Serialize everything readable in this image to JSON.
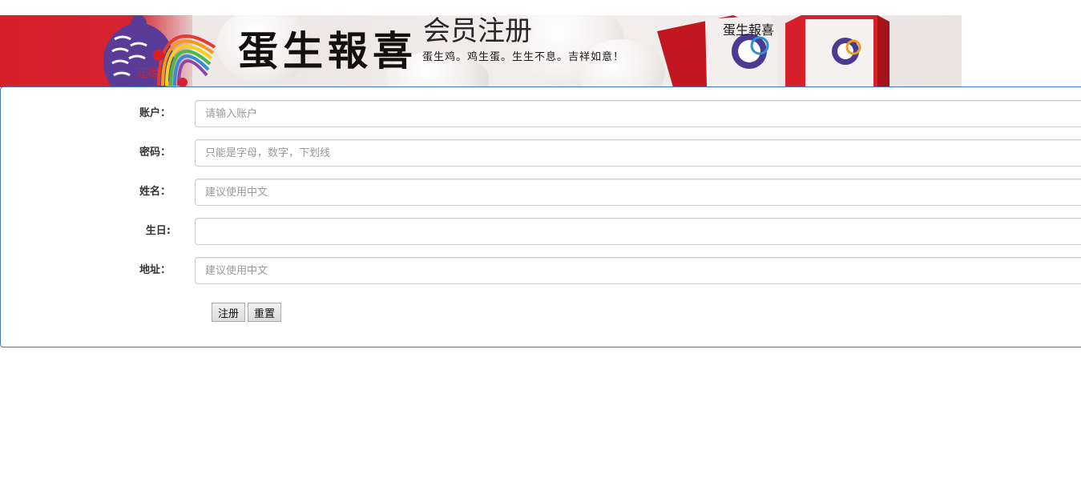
{
  "banner": {
    "logo_text": "元祖",
    "brand_text": "蛋生報喜",
    "title": "会员注册",
    "slogan": "蛋生鸡。鸡生蛋。生生不息。吉祥如意！",
    "box_brand_text": "蛋生報喜"
  },
  "form": {
    "fields": [
      {
        "label": "账户：",
        "placeholder": "请输入账户",
        "value": ""
      },
      {
        "label": "密码：",
        "placeholder": "只能是字母，数字，下划线",
        "value": ""
      },
      {
        "label": "姓名：",
        "placeholder": "建议使用中文",
        "value": ""
      },
      {
        "label": "生日:",
        "placeholder": "",
        "value": ""
      },
      {
        "label": "地址：",
        "placeholder": "建议使用中文",
        "value": ""
      }
    ],
    "submit_label": "注册",
    "reset_label": "重置"
  },
  "colors": {
    "banner_red": "#d8202a",
    "panel_border": "#3c7ac1",
    "rooster_purple": "#5a3c96"
  }
}
